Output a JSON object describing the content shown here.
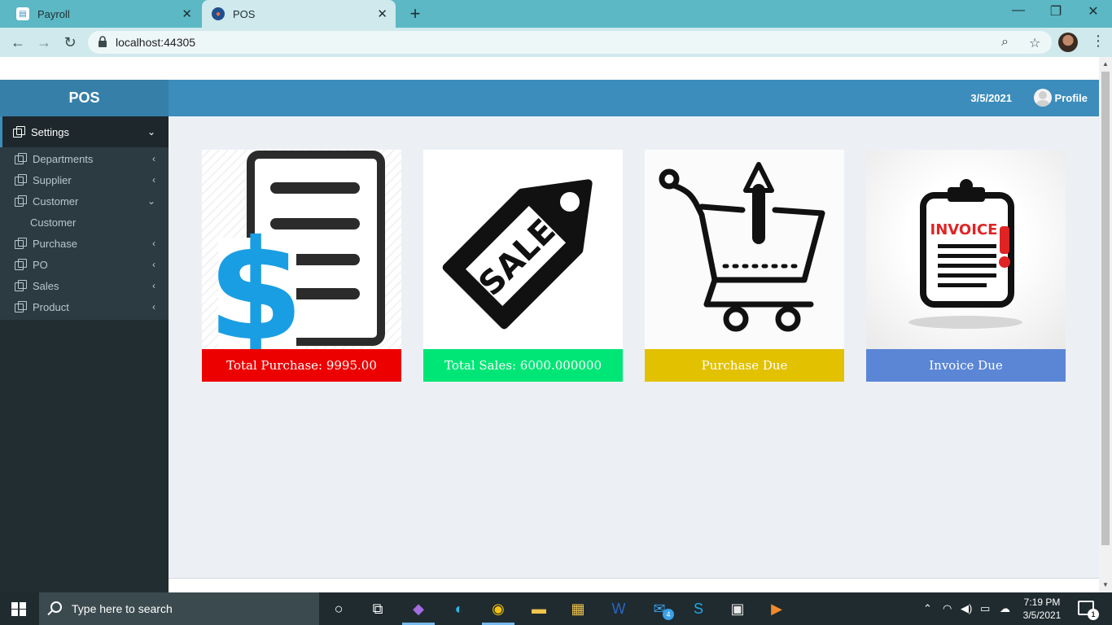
{
  "browser": {
    "tabs": [
      {
        "title": "Payroll",
        "favicon": "payroll-favicon"
      },
      {
        "title": "POS",
        "favicon": "pos-favicon"
      }
    ],
    "url": "localhost:44305"
  },
  "app": {
    "logo": "POS",
    "header": {
      "date": "3/5/2021",
      "profile_label": "Profile"
    },
    "sidebar": {
      "settings_label": "Settings",
      "items": [
        {
          "label": "Departments",
          "expanded": false
        },
        {
          "label": "Supplier",
          "expanded": false
        },
        {
          "label": "Customer",
          "expanded": true,
          "children": [
            "Customer"
          ]
        },
        {
          "label": "Purchase",
          "expanded": false
        },
        {
          "label": "PO",
          "expanded": false
        },
        {
          "label": "Sales",
          "expanded": false
        },
        {
          "label": "Product",
          "expanded": false
        }
      ]
    },
    "cards": [
      {
        "label": "Total Purchase: 9995.00",
        "color": "#ec0000",
        "icon": "purchase-document-dollar-icon"
      },
      {
        "label": "Total Sales: 6000.000000",
        "color": "#00e676",
        "icon": "sale-tag-icon"
      },
      {
        "label": "Purchase Due",
        "color": "#e2c100",
        "icon": "cart-upload-icon"
      },
      {
        "label": "Invoice Due",
        "color": "#5b86d6",
        "icon": "invoice-clipboard-icon"
      }
    ],
    "sale_tag_text": "SALE",
    "invoice_text": "INVOICE"
  },
  "taskbar": {
    "search_placeholder": "Type here to search",
    "time": "7:19 PM",
    "date": "3/5/2021",
    "mail_badge": "4",
    "notification_badge": "1"
  }
}
